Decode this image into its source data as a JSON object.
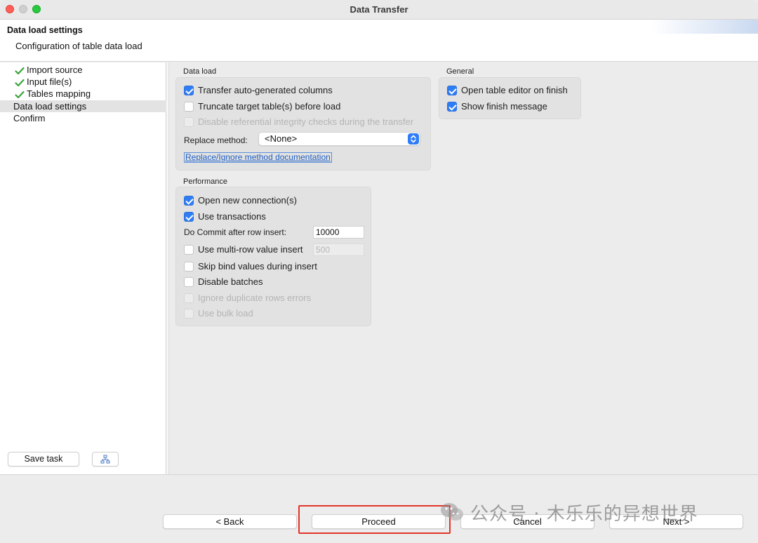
{
  "window": {
    "title": "Data Transfer"
  },
  "header": {
    "title": "Data load settings",
    "subtitle": "Configuration of table data load"
  },
  "nav": {
    "items": [
      {
        "label": "Import source",
        "checked": true
      },
      {
        "label": "Input file(s)",
        "checked": true
      },
      {
        "label": "Tables mapping",
        "checked": true
      },
      {
        "label": "Data load settings",
        "checked": false,
        "selected": true
      },
      {
        "label": "Confirm",
        "checked": false
      }
    ],
    "save_task_label": "Save task",
    "task_icon": "task-hierarchy-icon"
  },
  "data_load": {
    "group_label": "Data load",
    "transfer_auto_generated": {
      "label": "Transfer auto-generated columns",
      "checked": true
    },
    "truncate_target": {
      "label": "Truncate target table(s) before load",
      "checked": false
    },
    "disable_integrity": {
      "label": "Disable referential integrity checks during the transfer",
      "checked": false,
      "disabled": true
    },
    "replace_method_label": "Replace method:",
    "replace_method_value": "<None>",
    "doc_link": "Replace/Ignore method documentation"
  },
  "general": {
    "group_label": "General",
    "open_editor": {
      "label": "Open table editor on finish",
      "checked": true
    },
    "show_finish": {
      "label": "Show finish message",
      "checked": true
    }
  },
  "performance": {
    "group_label": "Performance",
    "open_new_connection": {
      "label": "Open new connection(s)",
      "checked": true
    },
    "use_transactions": {
      "label": "Use transactions",
      "checked": true
    },
    "commit_label": "Do Commit after row insert:",
    "commit_value": "10000",
    "multi_row": {
      "label": "Use multi-row value insert",
      "checked": false
    },
    "multi_row_value": "500",
    "skip_bind": {
      "label": "Skip bind values during insert",
      "checked": false
    },
    "disable_batches": {
      "label": "Disable batches",
      "checked": false
    },
    "ignore_duplicate": {
      "label": "Ignore duplicate rows errors",
      "checked": false,
      "disabled": true
    },
    "bulk_load": {
      "label": "Use bulk load",
      "checked": false,
      "disabled": true
    }
  },
  "footer": {
    "back_label": "< Back",
    "proceed_label": "Proceed",
    "cancel_label": "Cancel",
    "next_label": "Next >"
  },
  "watermark": {
    "text": "公众号 · 木乐乐的异想世界"
  },
  "colors": {
    "accent": "#2f7df6",
    "highlight": "#e2352a",
    "check_green": "#3aa43a"
  }
}
